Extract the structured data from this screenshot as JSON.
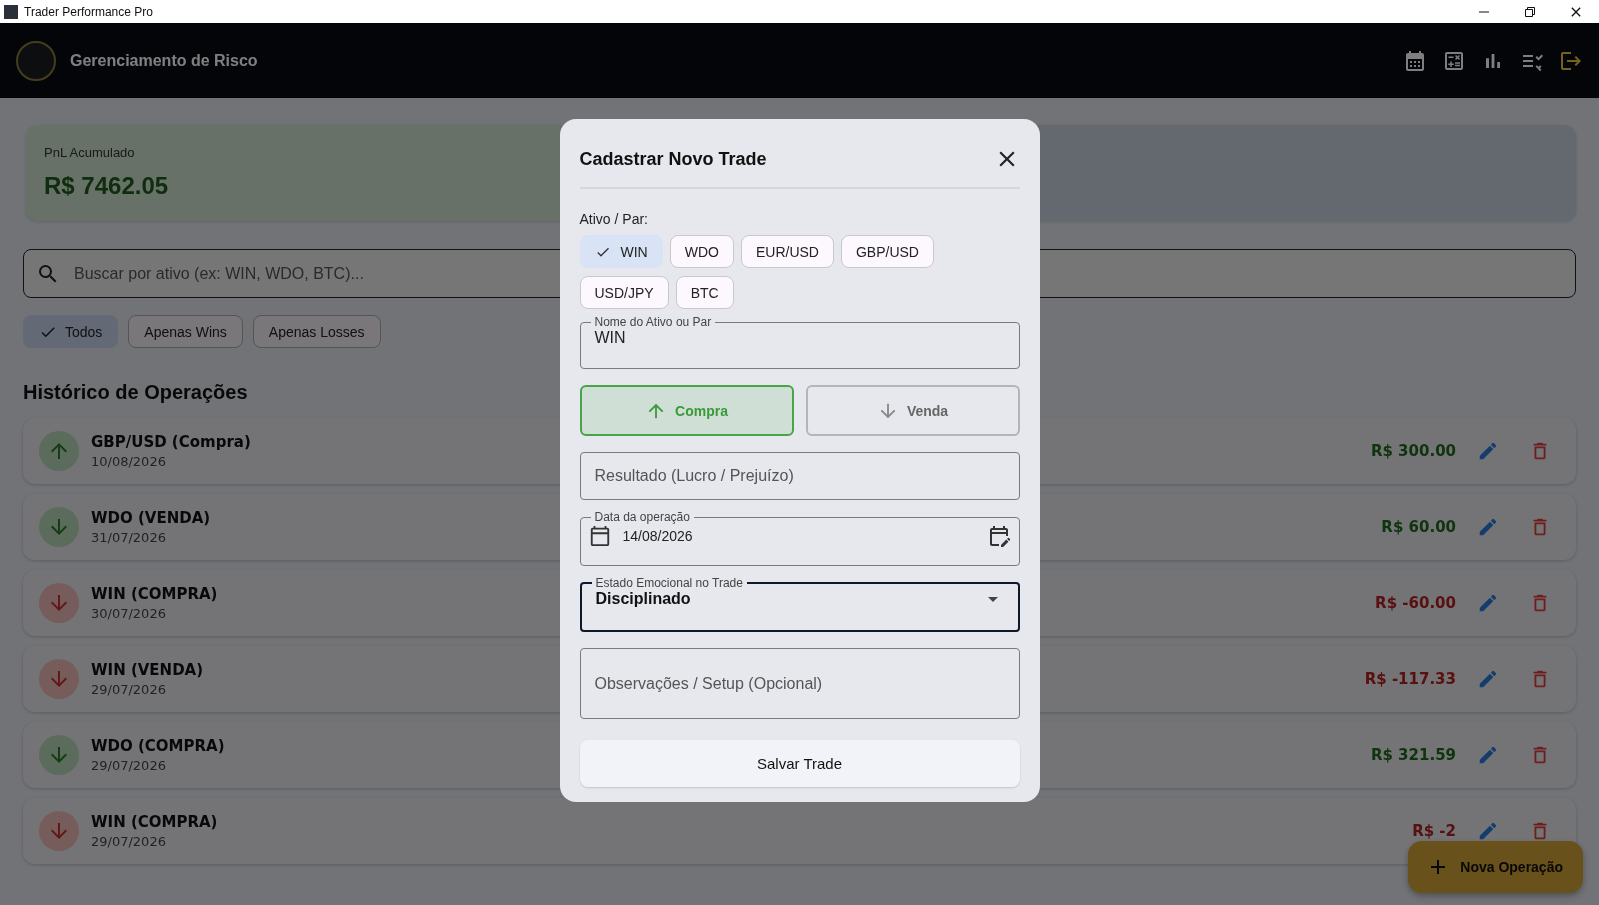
{
  "window": {
    "title": "Trader Performance Pro"
  },
  "header": {
    "title": "Gerenciamento de Risco"
  },
  "summary_cards": [
    {
      "kind": "profit",
      "label": "PnL Acumulado",
      "value": "R$ 7462.05"
    },
    {
      "kind": "neutral"
    }
  ],
  "search": {
    "placeholder": "Buscar por ativo (ex: WIN, WDO, BTC)..."
  },
  "filters": [
    {
      "label": "Todos",
      "selected": true
    },
    {
      "label": "Apenas Wins",
      "selected": false
    },
    {
      "label": "Apenas Losses",
      "selected": false
    }
  ],
  "history": {
    "title": "Histórico de Operações",
    "rows": [
      {
        "title": "GBP/USD (Compra)",
        "date": "10/08/2026",
        "arrow_up": true,
        "win": true,
        "amount": "R$ 300.00"
      },
      {
        "title": "WDO (VENDA)",
        "date": "31/07/2026",
        "arrow_up": false,
        "win": true,
        "amount": "R$ 60.00"
      },
      {
        "title": "WIN (COMPRA)",
        "date": "30/07/2026",
        "arrow_up": false,
        "win": false,
        "amount": "R$ -60.00"
      },
      {
        "title": "WIN (VENDA)",
        "date": "29/07/2026",
        "arrow_up": false,
        "win": false,
        "amount": "R$ -117.33"
      },
      {
        "title": "WDO (COMPRA)",
        "date": "29/07/2026",
        "arrow_up": false,
        "win": true,
        "amount": "R$ 321.59"
      },
      {
        "title": "WIN (COMPRA)",
        "date": "29/07/2026",
        "arrow_up": false,
        "win": false,
        "amount": "R$ -2"
      }
    ]
  },
  "fab": {
    "label": "Nova Operação"
  },
  "dialog": {
    "title": "Cadastrar Novo Trade",
    "asset_label": "Ativo / Par:",
    "assets": [
      {
        "label": "WIN",
        "selected": true
      },
      {
        "label": "WDO",
        "selected": false
      },
      {
        "label": "EUR/USD",
        "selected": false
      },
      {
        "label": "GBP/USD",
        "selected": false
      },
      {
        "label": "USD/JPY",
        "selected": false
      },
      {
        "label": "BTC",
        "selected": false
      }
    ],
    "asset_field": {
      "label": "Nome do Ativo ou Par",
      "value": "WIN"
    },
    "sides": [
      {
        "label": "Compra",
        "arrow_up": true,
        "selected": true
      },
      {
        "label": "Venda",
        "arrow_up": false,
        "selected": false
      }
    ],
    "result_field": {
      "placeholder": "Resultado (Lucro / Prejuízo)"
    },
    "date_field": {
      "label": "Data da operação",
      "value": "14/08/2026"
    },
    "emotion_field": {
      "label": "Estado Emocional no Trade",
      "value": "Disciplinado",
      "focused": true
    },
    "notes_field": {
      "placeholder": "Observações / Setup (Opcional)"
    },
    "save_button": "Salvar Trade"
  }
}
